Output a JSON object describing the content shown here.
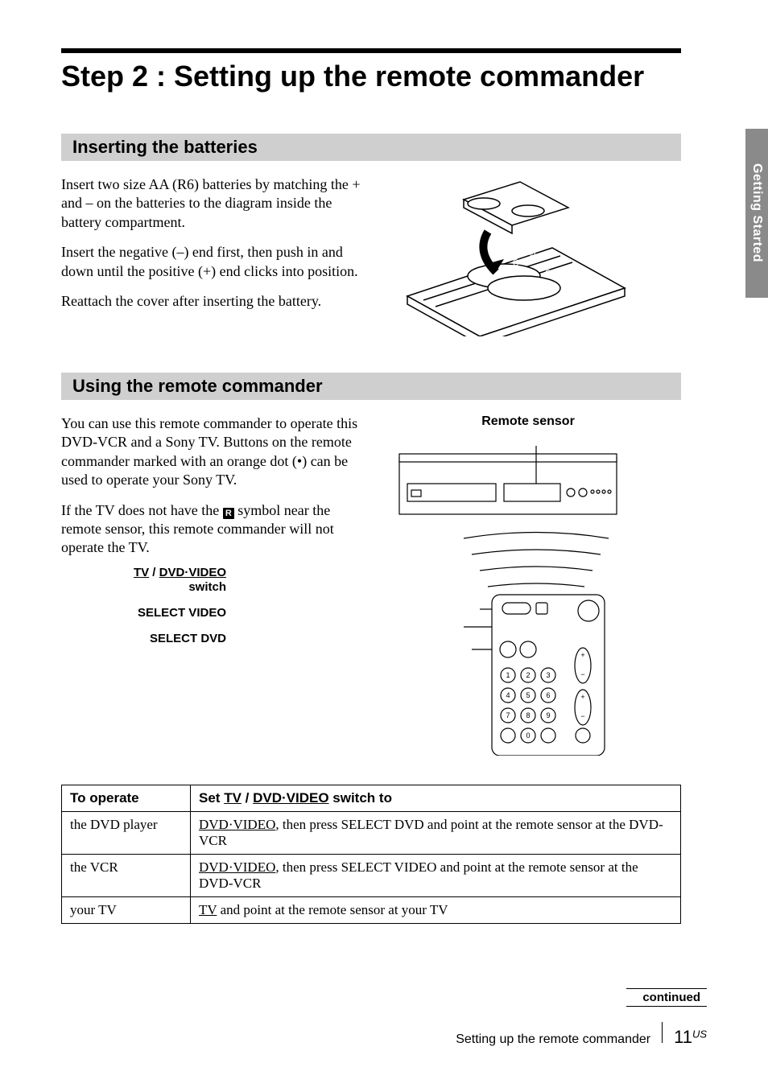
{
  "tab": "Getting Started",
  "title": "Step 2 : Setting up the remote commander",
  "section1": {
    "heading": "Inserting the batteries",
    "p1": "Insert two size AA (R6) batteries by matching the + and – on the batteries to the diagram inside the battery compartment.",
    "p2": "Insert the negative (–) end first, then push in and down until the positive (+) end clicks into position.",
    "p3": "Reattach the cover after inserting the battery."
  },
  "section2": {
    "heading": "Using the remote commander",
    "p1a": "You can use this remote commander to operate this DVD-VCR and a Sony TV. Buttons on the remote commander marked with an orange dot (•) can be used to operate your Sony TV.",
    "p1b_pre": "If the TV does not have the ",
    "p1b_post": " symbol near the remote sensor, this remote commander will not operate the TV.",
    "sensor_label": "Remote sensor",
    "callouts": {
      "switch_tv": "TV",
      "switch_sep": " / ",
      "switch_dvd": "DVD·VIDEO",
      "switch_word": "switch",
      "select_video": "SELECT VIDEO",
      "select_dvd": "SELECT DVD"
    }
  },
  "table": {
    "h1": "To operate",
    "h2_pre": "Set ",
    "h2_tv": "TV",
    "h2_sep": " / ",
    "h2_dvd": "DVD·VIDEO",
    "h2_post": " switch to",
    "rows": [
      {
        "c1": "the DVD player",
        "c2_u": "DVD·VIDEO",
        "c2_rest": ", then press SELECT DVD and point at the remote sensor at the DVD-VCR"
      },
      {
        "c1": "the VCR",
        "c2_u": "DVD·VIDEO",
        "c2_rest": ", then press SELECT VIDEO and point at the remote sensor at the DVD-VCR"
      },
      {
        "c1": "your TV",
        "c2_u": "TV",
        "c2_rest": " and point at the remote sensor at your TV"
      }
    ]
  },
  "continued": "continued",
  "footer": {
    "title": "Setting up the remote commander",
    "page": "11",
    "region": "US"
  },
  "icon_r": "R"
}
